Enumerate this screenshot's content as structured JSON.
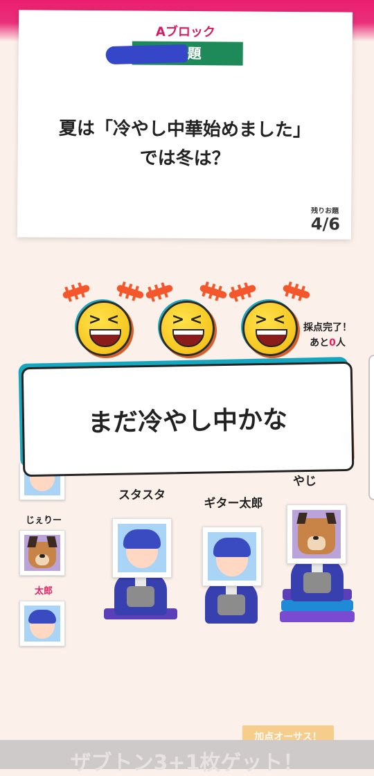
{
  "header": {
    "block_label": "Aブロック",
    "odai_tag": "お題",
    "question_line1": "夏は「冷やし中華始めました」",
    "question_line2": "では冬は？",
    "remaining_label": "残りお題",
    "remaining_count": "4/6"
  },
  "reactions": {
    "emoji_names": [
      "laughing-face-icon",
      "laughing-face-icon",
      "laughing-face-icon"
    ],
    "eyes_glyph": "> <"
  },
  "scoring": {
    "status_line1": "採点完了！",
    "status_prefix": "あと",
    "remaining_num": "0",
    "status_suffix": "人"
  },
  "answer": {
    "text": "まだ冷やし中かな"
  },
  "side_players": [
    {
      "name": "じぇりー",
      "highlight": false,
      "avatar": "dog"
    },
    {
      "name": "太郎",
      "highlight": true,
      "avatar": "boy"
    }
  ],
  "stage_players": [
    {
      "name": "スタスタ",
      "avatar": "boy"
    },
    {
      "name": "ギター太郎",
      "avatar": "boy"
    },
    {
      "name": "やじ",
      "avatar": "dog"
    }
  ],
  "footer": {
    "score_button": "加点オーサス！",
    "banner": "ザブトン3+1枚ゲット！"
  },
  "colors": {
    "accent_pink": "#e91e63",
    "tag_green": "#1e8a5a",
    "card_teal": "#16a7c0",
    "card_orange": "#f05a28"
  }
}
